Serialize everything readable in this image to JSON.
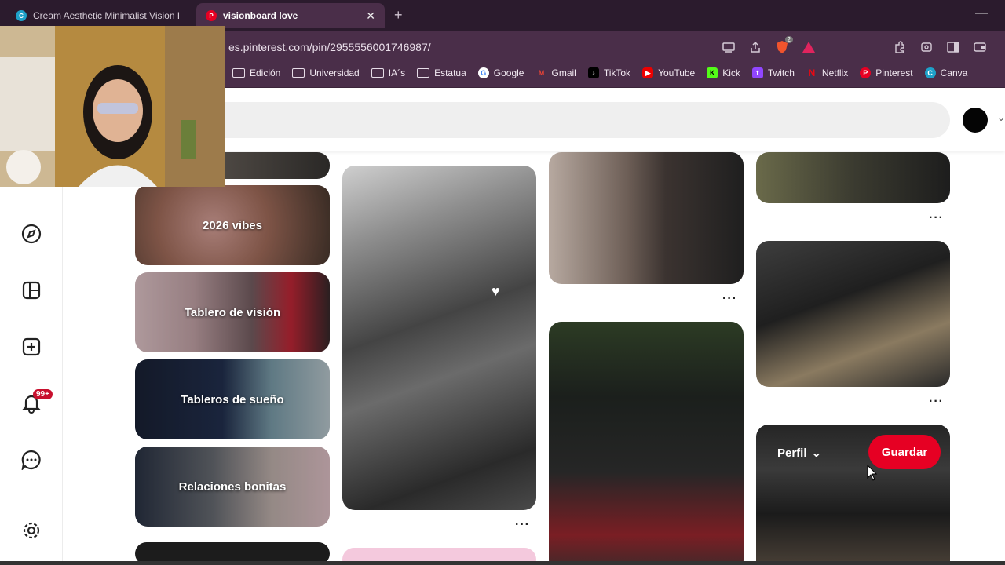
{
  "browser": {
    "tabs": [
      {
        "title": "Cream Aesthetic Minimalist Vision Bo",
        "favicon": "canva-icon",
        "active": false
      },
      {
        "title": "visionboard love",
        "favicon": "pinterest-icon",
        "active": true
      }
    ],
    "close_glyph": "✕",
    "new_tab_glyph": "+",
    "minimize_glyph": "—",
    "url": "es.pinterest.com/pin/2955556001746987/",
    "bookmarks": [
      {
        "label": "Edición",
        "icon": "folder-icon"
      },
      {
        "label": "Universidad",
        "icon": "folder-icon"
      },
      {
        "label": "IA´s",
        "icon": "folder-icon"
      },
      {
        "label": "Estatua",
        "icon": "folder-icon"
      },
      {
        "label": "Google",
        "icon": "google-icon"
      },
      {
        "label": "Gmail",
        "icon": "gmail-icon"
      },
      {
        "label": "TikTok",
        "icon": "tiktok-icon"
      },
      {
        "label": "YouTube",
        "icon": "youtube-icon"
      },
      {
        "label": "Kick",
        "icon": "kick-icon"
      },
      {
        "label": "Twitch",
        "icon": "twitch-icon"
      },
      {
        "label": "Netflix",
        "icon": "netflix-icon"
      },
      {
        "label": "Pinterest",
        "icon": "pinterest-icon"
      },
      {
        "label": "Canva",
        "icon": "canva-icon"
      }
    ],
    "brave_badge": "2"
  },
  "pinterest": {
    "notification_badge": "99+",
    "boards": [
      {
        "label": "2026 vibes"
      },
      {
        "label": "Tablero de visión"
      },
      {
        "label": "Tableros de sueño"
      },
      {
        "label": "Relaciones bonitas"
      }
    ],
    "pin_menu_glyph": "···",
    "hover_profile_label": "Perfil",
    "save_button_label": "Guardar"
  },
  "colors": {
    "chrome_dark": "#2b1b2d",
    "chrome_tab_active": "#4a2e49",
    "pinterest_red": "#e60023",
    "badge_red": "#c8102e"
  }
}
